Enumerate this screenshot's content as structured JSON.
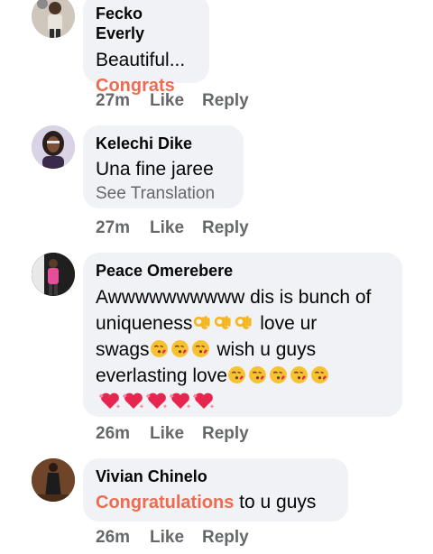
{
  "comments": [
    {
      "name": "Fecko Everly",
      "line1": "Beautiful...",
      "link": "Congrats",
      "time": "27m",
      "like": "Like",
      "reply": "Reply"
    },
    {
      "name": "Kelechi Dike",
      "line1": "Una fine jaree",
      "translate": "See Translation",
      "time": "27m",
      "like": "Like",
      "reply": "Reply"
    },
    {
      "name": "Peace Omerebere",
      "line1": "Awwwwwwwwww dis is bunch of",
      "line2a": "uniqueness",
      "line2b": " love ur",
      "line3a": "swags",
      "line3b": " wish u guys",
      "line4": "everlasting love",
      "time": "26m",
      "like": "Like",
      "reply": "Reply"
    },
    {
      "name": "Vivian Chinelo",
      "link": "Congratulations",
      "rest": " to u guys",
      "time": "26m",
      "like": "Like",
      "reply": "Reply"
    }
  ],
  "icons": {
    "ok_hand": "ok-hand-emoji",
    "kiss": "face-blowing-kiss-emoji",
    "heart": "sparkling-heart-emoji"
  },
  "colors": {
    "bubble": "#f0f2f5",
    "link": "#f06a4f",
    "meta": "#65676b"
  }
}
